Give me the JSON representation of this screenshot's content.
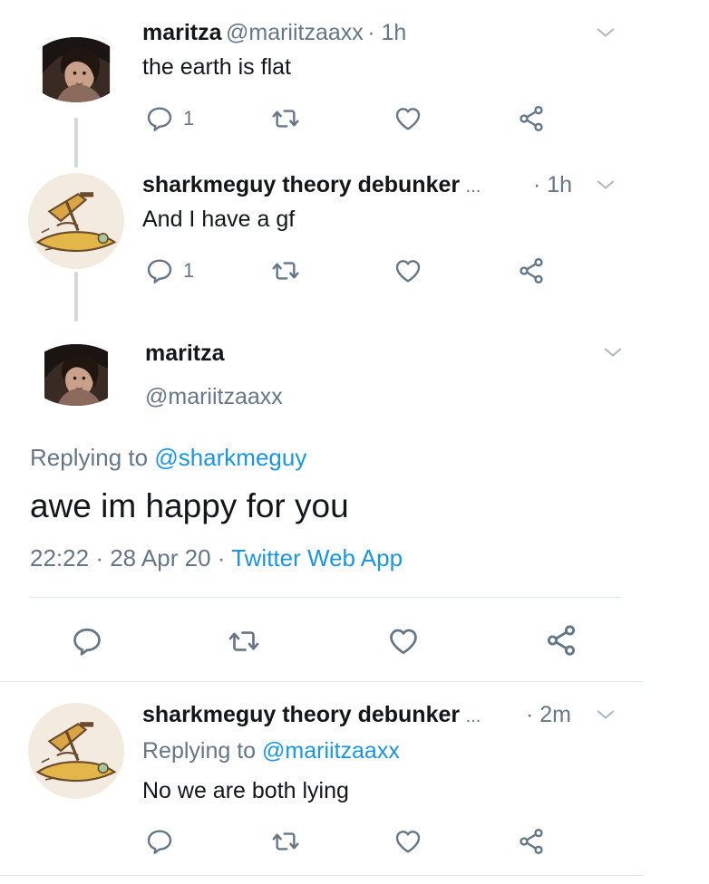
{
  "tweets": [
    {
      "name": "maritza",
      "handle": "@mariitzaaxx",
      "time": "· 1h",
      "text": "the earth is flat",
      "reply_count": "1",
      "avatar_icon": "profile-photo-woman"
    },
    {
      "name": "sharkmeguy theory debunker",
      "name_ellipsis": "...",
      "time": "· 1h",
      "text": "And I have a gf",
      "reply_count": "1",
      "avatar_icon": "profile-drawing-shark"
    }
  ],
  "focused": {
    "name": "maritza",
    "handle": "@mariitzaaxx",
    "replying_prefix": "Replying to",
    "replying_handle": "@sharkmeguy",
    "text": "awe im happy for you",
    "time": "22:22",
    "sep": "·",
    "date": "28 Apr 20",
    "source": "Twitter Web App"
  },
  "reply": {
    "name": "sharkmeguy theory debunker",
    "name_ellipsis": "...",
    "time": "· 2m",
    "replying_prefix": "Replying to",
    "replying_handle": "@mariitzaaxx",
    "text": "No we are both lying"
  },
  "colors": {
    "link": "#1b95e0",
    "muted": "#657786",
    "icon": "#657786",
    "divider": "#e1e8ed",
    "thread_line": "#cfd9de"
  }
}
